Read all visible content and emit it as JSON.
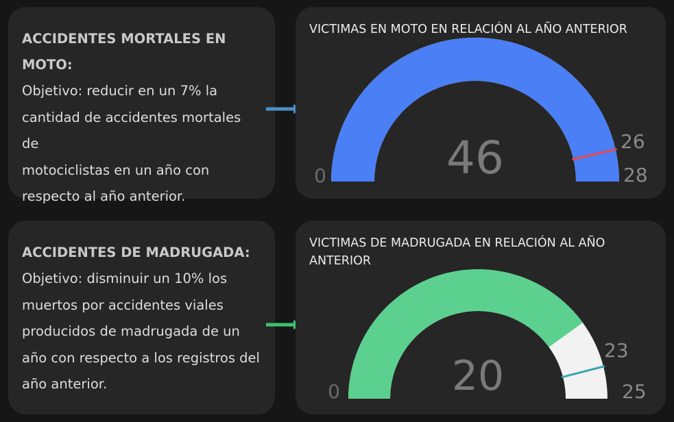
{
  "colors": {
    "background": "#161616",
    "card": "#262626",
    "blue": "#4a7ff5",
    "green": "#5cd18f",
    "track": "#f2f2f2",
    "target_red": "#e84a4a",
    "target_teal": "#3aa6b0"
  },
  "panels": [
    {
      "title": "ACCIDENTES MORTALES EN MOTO:",
      "lines": [
        "Objetivo: reducir en un 7% la",
        "cantidad de accidentes mortales de",
        "motociclistas en un año con",
        "respecto al año anterior."
      ]
    },
    {
      "title": "ACCIDENTES DE MADRUGADA:",
      "lines": [
        "Objetivo: disminuir un 10% los",
        "muertos por accidentes viales",
        "producidos de madrugada de un",
        "año con respecto a los registros del",
        "año anterior."
      ]
    }
  ],
  "chart_data": [
    {
      "type": "gauge",
      "title": "VICTIMAS EN MOTO EN RELACIÓN AL AÑO ANTERIOR",
      "value": 46,
      "value_label": "46",
      "min": 0,
      "min_label": "0",
      "max": 28,
      "max_label": "28",
      "target": 26,
      "target_label": "26",
      "fill_color": "#4a7ff5",
      "target_color": "#e84a4a"
    },
    {
      "type": "gauge",
      "title": "VICTIMAS DE MADRUGADA EN RELACIÓN AL AÑO ANTERIOR",
      "value": 20,
      "value_label": "20",
      "min": 0,
      "min_label": "0",
      "max": 25,
      "max_label": "25",
      "target": 23,
      "target_label": "23",
      "fill_color": "#5cd18f",
      "target_color": "#3aa6b0"
    }
  ]
}
